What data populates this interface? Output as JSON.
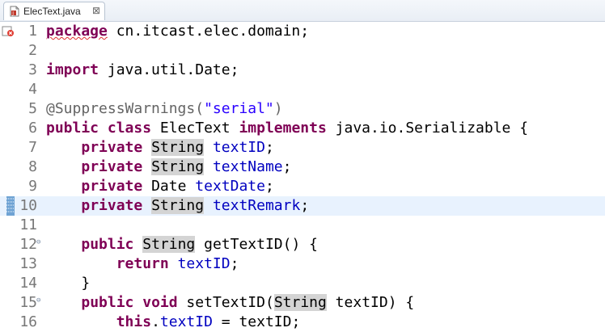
{
  "tab": {
    "filename": "ElecText.java",
    "close_glyph": "⊠",
    "icon": "java-file-icon"
  },
  "gutter": {
    "warning_icon": "error-marker-icon",
    "bookmark_icon": "current-line-marker-icon",
    "fold_glyph": "⊖"
  },
  "code": {
    "line_numbers": [
      "1",
      "2",
      "3",
      "4",
      "5",
      "6",
      "7",
      "8",
      "9",
      "10",
      "11",
      "12",
      "13",
      "14",
      "15",
      "16"
    ],
    "l1": {
      "kw": "package",
      "rest": " cn.itcast.elec.domain;"
    },
    "l3": {
      "kw": "import",
      "rest": " java.util.Date;"
    },
    "l5": {
      "ann": "@SuppressWarnings(",
      "str": "\"serial\"",
      "close": ")"
    },
    "l6": {
      "kw1": "public",
      "kw2": "class",
      "name": " ElecText ",
      "kw3": "implements",
      "rest": " java.io.Serializable {"
    },
    "l7": {
      "indent": "    ",
      "kw": "private",
      "type": "String",
      "field": "textID",
      "semi": ";"
    },
    "l8": {
      "indent": "    ",
      "kw": "private",
      "type": "String",
      "field": "textName",
      "semi": ";"
    },
    "l9": {
      "indent": "    ",
      "kw": "private",
      "type": "Date",
      "field": "textDate",
      "semi": ";"
    },
    "l10": {
      "indent": "    ",
      "kw": "private",
      "type": "String",
      "field": "textRemark",
      "semi": ";"
    },
    "l12": {
      "indent": "    ",
      "kw": "public",
      "type": "String",
      "rest": " getTextID() {"
    },
    "l13": {
      "indent": "        ",
      "kw": "return",
      "field": "textID",
      "semi": ";"
    },
    "l14": {
      "text": "    }"
    },
    "l15": {
      "indent": "    ",
      "kw1": "public",
      "kw2": "void",
      "method": " setTextID(",
      "type": "String",
      "rest": " textID) {"
    },
    "l16": {
      "indent": "        ",
      "kw": "this",
      "dot": ".",
      "field": "textID",
      "rest": " = textID;"
    }
  }
}
